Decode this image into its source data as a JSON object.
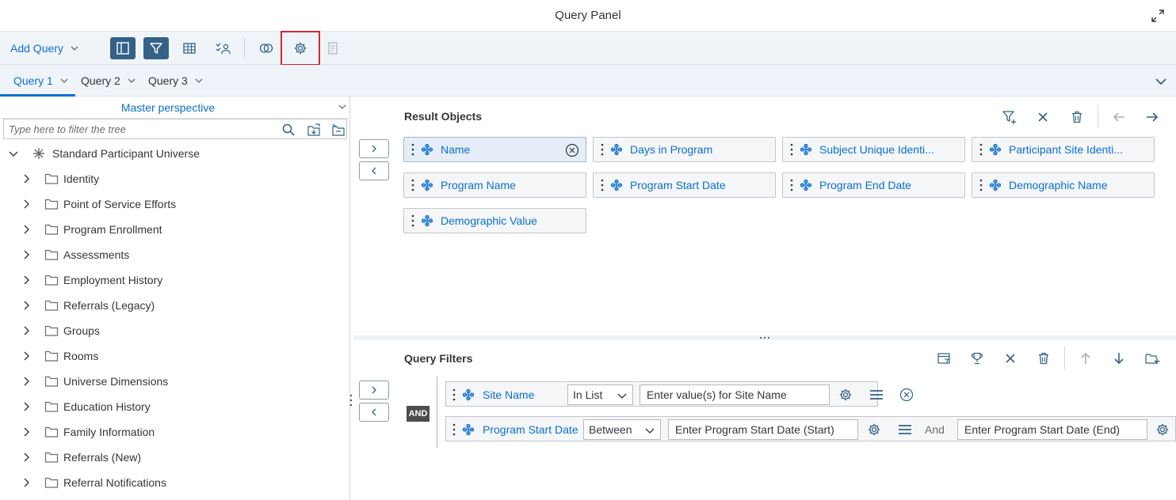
{
  "window": {
    "title": "Query Panel"
  },
  "toolbar": {
    "add_query_label": "Add Query"
  },
  "query_tabs": [
    {
      "label": "Query 1"
    },
    {
      "label": "Query 2"
    },
    {
      "label": "Query 3"
    }
  ],
  "left_panel": {
    "perspective": "Master perspective",
    "filter_placeholder": "Type here to filter the tree",
    "universe": "Standard Participant Universe",
    "folders": [
      "Identity",
      "Point of Service Efforts",
      "Program Enrollment",
      "Assessments",
      "Employment History",
      "Referrals (Legacy)",
      "Groups",
      "Rooms",
      "Universe Dimensions",
      "Education History",
      "Family Information",
      "Referrals (New)",
      "Referral Notifications"
    ]
  },
  "result_objects": {
    "title": "Result Objects",
    "items": [
      "Name",
      "Days in Program",
      "Subject Unique Identi...",
      "Participant Site Identi...",
      "Program Name",
      "Program Start Date",
      "Program End Date",
      "Demographic Name",
      "Demographic Value"
    ]
  },
  "query_filters": {
    "title": "Query Filters",
    "and_label": "AND",
    "filters": [
      {
        "name": "Site Name",
        "operator": "In List",
        "value1": "Enter value(s) for Site Name"
      },
      {
        "name": "Program Start Date",
        "operator": "Between",
        "value1": "Enter Program Start Date (Start)",
        "joiner": "And",
        "value2": "Enter Program Start Date (End)"
      }
    ]
  },
  "colors": {
    "accent": "#0a6ed1",
    "active_button": "#346187",
    "highlight": "#d9262c",
    "toolbar_bg": "#eff4f9"
  }
}
